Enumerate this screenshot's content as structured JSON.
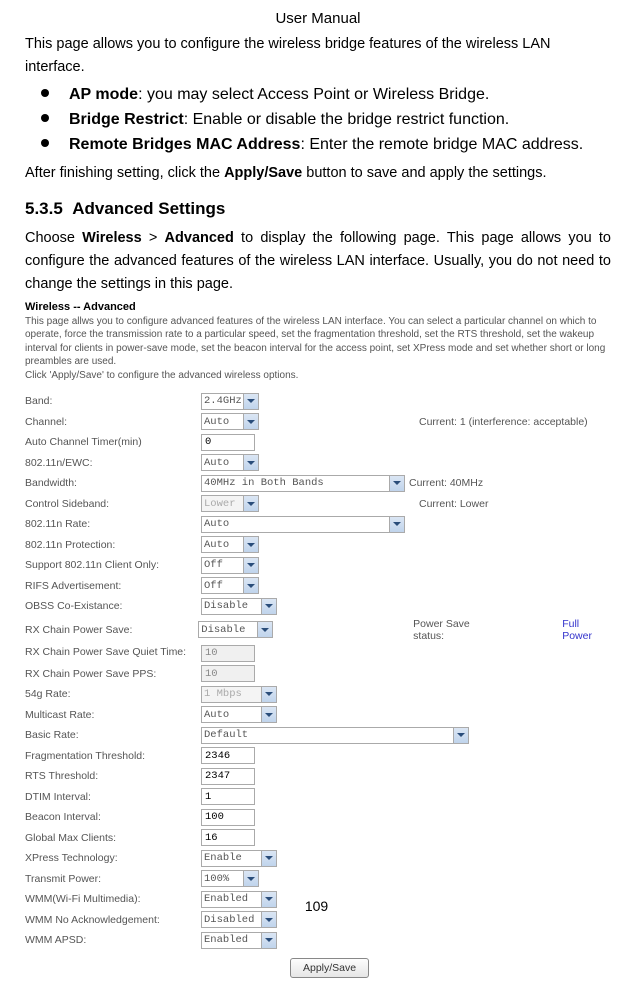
{
  "header": {
    "title": "User Manual"
  },
  "intro": "This page allows you to configure the wireless bridge features of the wireless LAN interface.",
  "bullets": [
    {
      "label": "AP mode",
      "text": ": you may select Access Point or Wireless Bridge."
    },
    {
      "label": "Bridge Restrict",
      "text": ": Enable or disable the bridge restrict function."
    },
    {
      "label": "Remote Bridges MAC Address",
      "text": ": Enter the remote bridge MAC address."
    }
  ],
  "after": {
    "pre": "After finishing setting, click the ",
    "bold": "Apply/Save",
    "post": " button to save and apply the settings."
  },
  "section": {
    "number": "5.3.5",
    "title": "Advanced Settings",
    "text_pre": "Choose ",
    "b1": "Wireless",
    "gt": " > ",
    "b2": "Advanced",
    "text_post": " to display the following page. This page allows you to configure the advanced features of the wireless LAN interface. Usually, you do not need to change the settings in this page."
  },
  "screenshot": {
    "title": "Wireless -- Advanced",
    "desc": "This page allws you to configure advanced features of the wireless LAN interface. You can select a particular channel on which to operate, force the transmission rate to a particular speed, set the fragmentation threshold, set the RTS threshold, set the wakeup interval for clients in power-save mode, set the beacon interval for the access point, set XPress mode and set whether short or long preambles are used.",
    "desc2": "Click 'Apply/Save' to configure the advanced wireless options.",
    "rows": {
      "band": {
        "label": "Band:",
        "value": "2.4GHz"
      },
      "channel": {
        "label": "Channel:",
        "value": "Auto",
        "extra": "Current: 1 (interference: acceptable)"
      },
      "auto_timer": {
        "label": "Auto Channel Timer(min)",
        "value": "0"
      },
      "ewc": {
        "label": "802.11n/EWC:",
        "value": "Auto"
      },
      "bandwidth": {
        "label": "Bandwidth:",
        "value": "40MHz in Both Bands",
        "extra": "Current: 40MHz"
      },
      "sideband": {
        "label": "Control Sideband:",
        "value": "Lower",
        "extra": "Current: Lower"
      },
      "rate11n": {
        "label": "802.11n Rate:",
        "value": "Auto"
      },
      "protection": {
        "label": "802.11n Protection:",
        "value": "Auto"
      },
      "client_only": {
        "label": "Support 802.11n Client Only:",
        "value": "Off"
      },
      "rifs": {
        "label": "RIFS Advertisement:",
        "value": "Off"
      },
      "obss": {
        "label": "OBSS Co-Existance:",
        "value": "Disable"
      },
      "rx_chain": {
        "label": "RX Chain Power Save:",
        "value": "Disable",
        "extra_label": "Power Save status:",
        "extra_value": "Full Power"
      },
      "rx_quiet": {
        "label": "RX Chain Power Save Quiet Time:",
        "value": "10"
      },
      "rx_pps": {
        "label": "RX Chain Power Save PPS:",
        "value": "10"
      },
      "s4g": {
        "label": "54g Rate:",
        "value": "1 Mbps"
      },
      "multicast": {
        "label": "Multicast Rate:",
        "value": "Auto"
      },
      "basic": {
        "label": "Basic Rate:",
        "value": "Default"
      },
      "frag": {
        "label": "Fragmentation Threshold:",
        "value": "2346"
      },
      "rts": {
        "label": "RTS Threshold:",
        "value": "2347"
      },
      "dtim": {
        "label": "DTIM Interval:",
        "value": "1"
      },
      "beacon": {
        "label": "Beacon Interval:",
        "value": "100"
      },
      "maxclients": {
        "label": "Global Max Clients:",
        "value": "16"
      },
      "xpress": {
        "label": "XPress Technology:",
        "value": "Enable"
      },
      "txpower": {
        "label": "Transmit Power:",
        "value": "100%"
      },
      "wmm": {
        "label": "WMM(Wi-Fi Multimedia):",
        "value": "Enabled"
      },
      "wmm_noack": {
        "label": "WMM No Acknowledgement:",
        "value": "Disabled"
      },
      "wmm_apsd": {
        "label": "WMM APSD:",
        "value": "Enabled"
      }
    },
    "button": "Apply/Save"
  },
  "page_number": "109"
}
